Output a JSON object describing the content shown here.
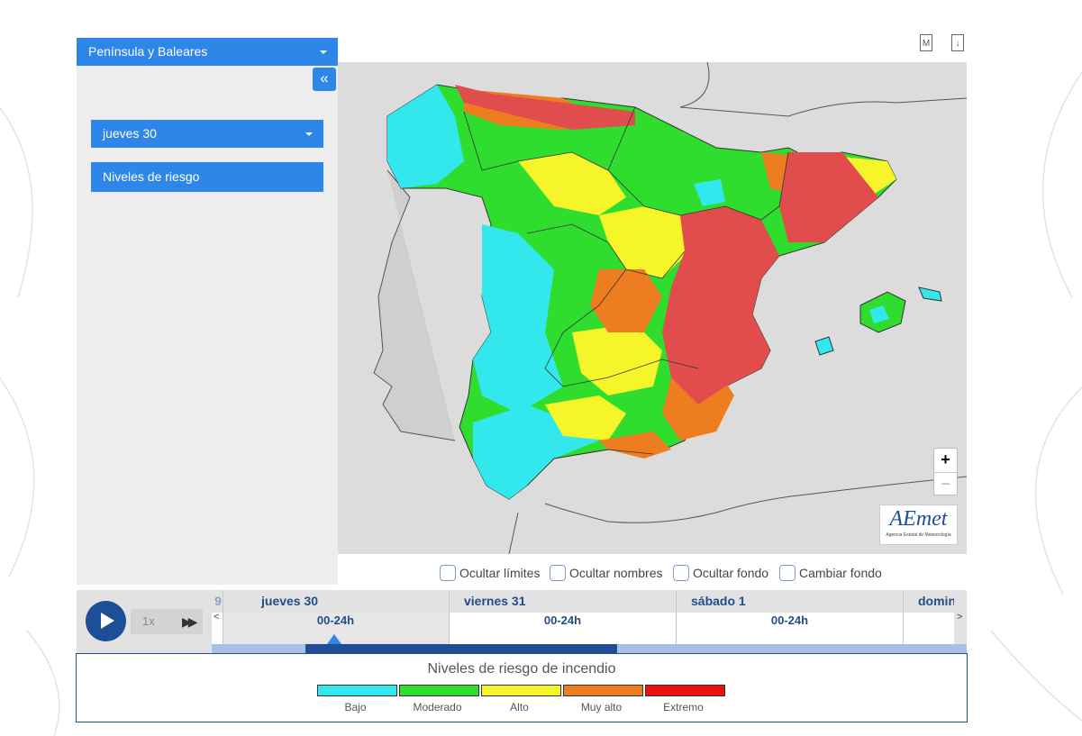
{
  "sidebar": {
    "region_select": "Península y Baleares",
    "collapse_icon": "«",
    "day_select": "jueves 30",
    "layer_button": "Niveles de riesgo"
  },
  "toolbar": {
    "icon_m": "M",
    "icon_download": "↓"
  },
  "map": {
    "zoom_in": "+",
    "zoom_out": "−",
    "logo_text": "AEmet",
    "logo_subtitle": "Agencia Estatal de Meteorología"
  },
  "options": [
    {
      "label": "Ocultar límites"
    },
    {
      "label": "Ocultar nombres"
    },
    {
      "label": "Ocultar fondo"
    },
    {
      "label": "Cambiar fondo"
    }
  ],
  "timeline": {
    "speed": "1x",
    "prev_day_fragment": "9",
    "prev_arrow": "<",
    "next_arrow": ">",
    "days": [
      {
        "name": "jueves 30",
        "period": "00-24h"
      },
      {
        "name": "viernes 31",
        "period": "00-24h"
      },
      {
        "name": "sábado 1",
        "period": "00-24h"
      },
      {
        "name": "doming",
        "period": ""
      }
    ]
  },
  "legend": {
    "title": "Niveles de riesgo de incendio",
    "levels": [
      {
        "label": "Bajo",
        "color": "#33e8ec"
      },
      {
        "label": "Moderado",
        "color": "#2fdd2f"
      },
      {
        "label": "Alto",
        "color": "#f5f52a"
      },
      {
        "label": "Muy alto",
        "color": "#ee7d22"
      },
      {
        "label": "Extremo",
        "color": "#ee1111"
      }
    ]
  },
  "colors": {
    "accent": "#2d86e8",
    "dark_blue": "#1f4e94"
  }
}
